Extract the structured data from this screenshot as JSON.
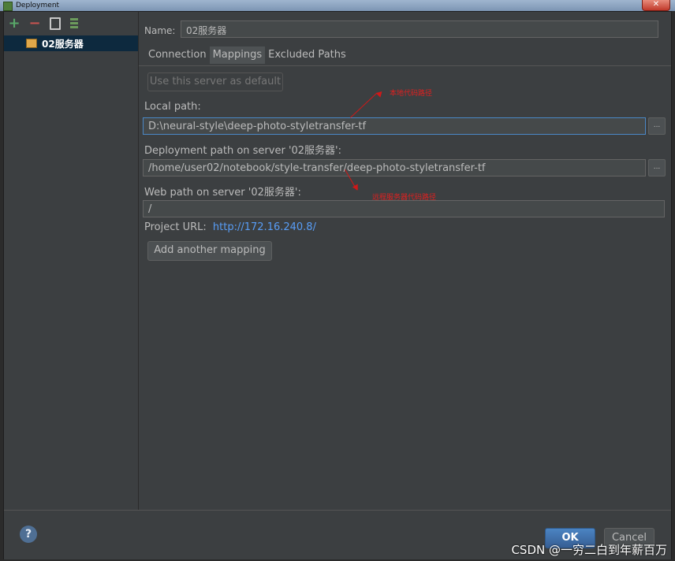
{
  "window": {
    "title": "Deployment",
    "close_glyph": "✕"
  },
  "toolbar": {
    "add": "+",
    "remove": "−"
  },
  "server_list": [
    {
      "label": "02服务器",
      "icon": "server-icon"
    }
  ],
  "form": {
    "name_label": "Name:",
    "name_value": "02服务器",
    "tabs": [
      "Connection",
      "Mappings",
      "Excluded Paths"
    ],
    "active_tab": "Mappings",
    "use_default_label": "Use this server as default",
    "local_path_label": "Local path:",
    "local_path_value": "D:\\neural-style\\deep-photo-styletransfer-tf",
    "deploy_path_label": "Deployment path on server '02服务器':",
    "deploy_path_value": "/home/user02/notebook/style-transfer/deep-photo-styletransfer-tf",
    "web_path_label": "Web path on server '02服务器':",
    "web_path_value": "/",
    "project_url_label": "Project URL:",
    "project_url_value": "http://172.16.240.8/",
    "add_mapping_label": "Add another mapping",
    "browse_glyph": "..."
  },
  "annotations": {
    "local": "本地代码路径",
    "remote": "远程服务器代码路径"
  },
  "footer": {
    "help": "?",
    "ok": "OK",
    "cancel": "Cancel"
  },
  "watermark": "CSDN @一穷二白到年薪百万"
}
